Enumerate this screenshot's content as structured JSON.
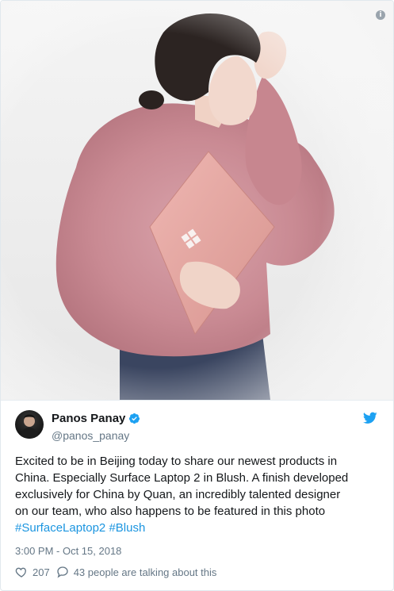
{
  "photo": {
    "alt_hint": "",
    "info_glyph": "i"
  },
  "author": {
    "display_name": "Panos Panay",
    "handle": "@panos_panay",
    "verified": true
  },
  "tweet": {
    "text_lines": [
      "Excited to be in Beijing today to share our newest products in",
      "China. Especially Surface Laptop 2 in Blush. A finish developed",
      "exclusively for China by Quan, an incredibly talented designer",
      "on our team, who also happens to be featured in this photo"
    ],
    "hashtags": [
      "#SurfaceLaptop2",
      "#Blush"
    ],
    "timestamp": "3:00 PM - Oct 15, 2018"
  },
  "engagement": {
    "likes": "207",
    "conversation": "43 people are talking about this"
  },
  "colors": {
    "link": "#1b95e0",
    "muted": "#657786",
    "verified": "#1da1f2",
    "twitter_bird": "#1da1f2",
    "sweater": "#c98a93",
    "laptop": "#e6a8a4"
  },
  "icons": {
    "info": "info-icon",
    "verified": "verified-badge-icon",
    "bird": "twitter-bird-icon",
    "like": "heart-icon",
    "reply": "speech-bubble-icon"
  }
}
